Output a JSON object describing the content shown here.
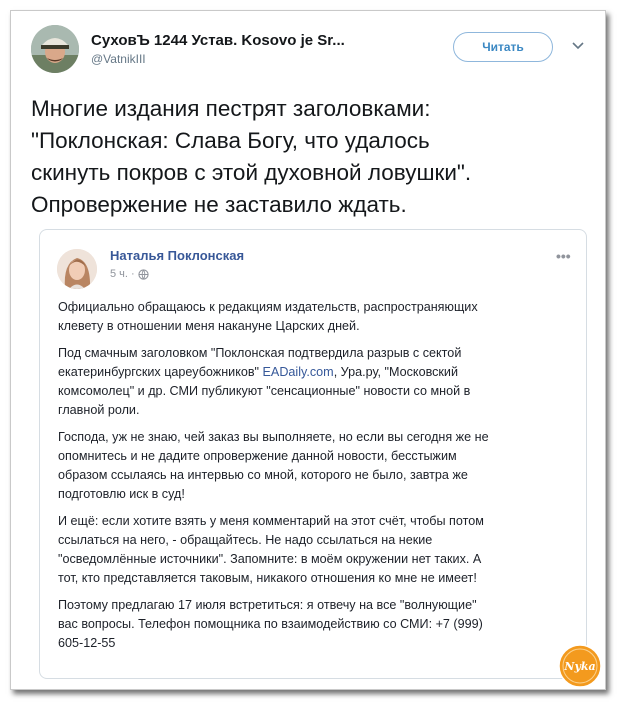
{
  "tweet": {
    "author_name": "СуховЪ 1244 Устав. Kosovo je Sr...",
    "author_handle": "@VatnikIII",
    "follow_label": "Читать",
    "text_lines": [
      "Многие издания пестрят заголовками:",
      "\"Поклонская: Слава Богу, что удалось",
      "скинуть покров с этой духовной ловушки\".",
      "Опровержение не заставило ждать."
    ]
  },
  "embedded_post": {
    "author_name": "Наталья Поклонская",
    "time": "5 ч.",
    "separator": "·",
    "more_label": "•••",
    "paragraphs": {
      "p1": [
        "Официально обращаюсь к редакциям издательств, распространяющих",
        "клевету в отношении меня накануне Царских дней."
      ],
      "p2": {
        "line1": "Под смачным заголовком \"Поклонская подтвердила разрыв с сектой",
        "line2_before_link": "екатеринбургских цареубожников\" ",
        "link_text": "EADaily.com",
        "line2_after_link": ", Ура.ру, \"Московский",
        "line3": "комсомолец\" и др. СМИ публикуют \"сенсационные\" новости со мной в",
        "line4": "главной роли."
      },
      "p3": [
        "Господа, уж не знаю, чей заказ вы выполняете, но если вы сегодня же не",
        "опомнитесь и не дадите опровержение данной новости, бесстыжим",
        "образом ссылаясь на интервью со мной, которого не было, завтра же",
        "подготовлю иск в суд!"
      ],
      "p4": [
        "И ещё: если хотите взять у меня комментарий на этот счёт, чтобы потом",
        "ссылаться на него, - обращайтесь. Не надо ссылаться на некие",
        "\"осведомлённые источники\". Запомните: в моём окружении нет таких. А",
        "тот, кто представляется таковым, никакого отношения ко мне не имеет!"
      ],
      "p5": [
        "Поэтому предлагаю 17 июля встретиться: я отвечу на все \"волнующие\"",
        "вас вопросы. Телефон помощника по взаимодействию со СМИ: +7 (999)",
        "605-12-55"
      ]
    }
  },
  "watermark": {
    "text": "Nyka"
  },
  "colors": {
    "follow_border": "#8fb7dc",
    "follow_text": "#3b88c3",
    "fb_name": "#385898",
    "fb_link": "#365899",
    "watermark_bg": "#f39a1e"
  }
}
